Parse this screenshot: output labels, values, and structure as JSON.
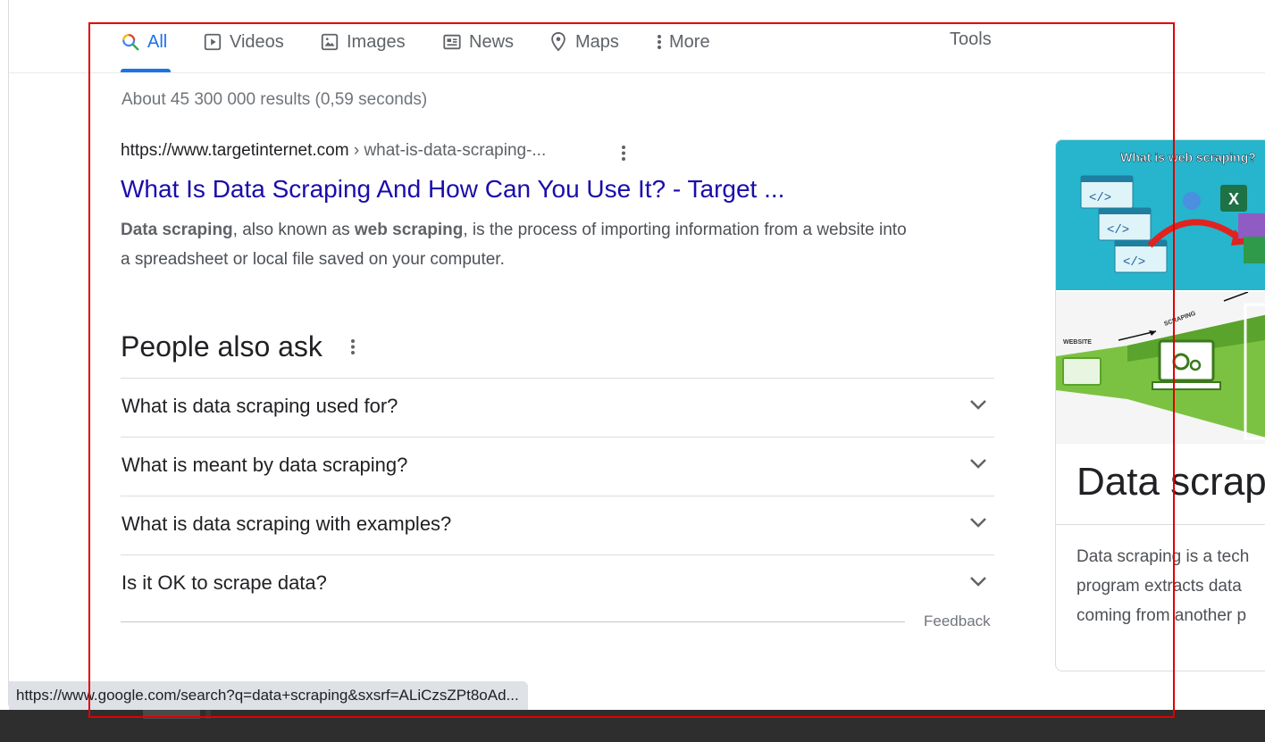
{
  "nav": {
    "tabs": [
      {
        "label": "All",
        "icon": "search-icon",
        "active": true
      },
      {
        "label": "Videos",
        "icon": "video-icon"
      },
      {
        "label": "Images",
        "icon": "image-icon"
      },
      {
        "label": "News",
        "icon": "news-icon"
      },
      {
        "label": "Maps",
        "icon": "map-pin-icon"
      },
      {
        "label": "More",
        "icon": "more-vert-icon"
      }
    ],
    "tools_label": "Tools"
  },
  "stats": "About 45 300 000 results (0,59 seconds)",
  "result": {
    "domain": "https://www.targetinternet.com",
    "path": " › what-is-data-scraping-...",
    "title": "What Is Data Scraping And How Can You Use It? - Target ...",
    "snippet_b1": "Data scraping",
    "snippet_t1": ", also known as ",
    "snippet_b2": "web scraping",
    "snippet_t2": ", is the process of importing information from a website into a spreadsheet or local file saved on your computer."
  },
  "people_also_ask": {
    "title": "People also ask",
    "questions": [
      "What is data scraping used for?",
      "What is meant by data scraping?",
      "What is data scraping with examples?",
      "Is it OK to scrape data?"
    ],
    "feedback": "Feedback"
  },
  "knowledge_panel": {
    "image1_caption": "What is web scraping?",
    "image2_label_website": "WEBSITE",
    "image2_label_scraping": "SCRAPING",
    "heading": "Data scrap",
    "description_lines": [
      "Data scraping is a tech",
      "program extracts data",
      "coming from another p"
    ]
  },
  "status_url": "https://www.google.com/search?q=data+scraping&sxsrf=ALiCzsZPt8oAd...",
  "colors": {
    "accent": "#1a73e8",
    "link": "#1a0dab",
    "annotation": "#e00000"
  }
}
